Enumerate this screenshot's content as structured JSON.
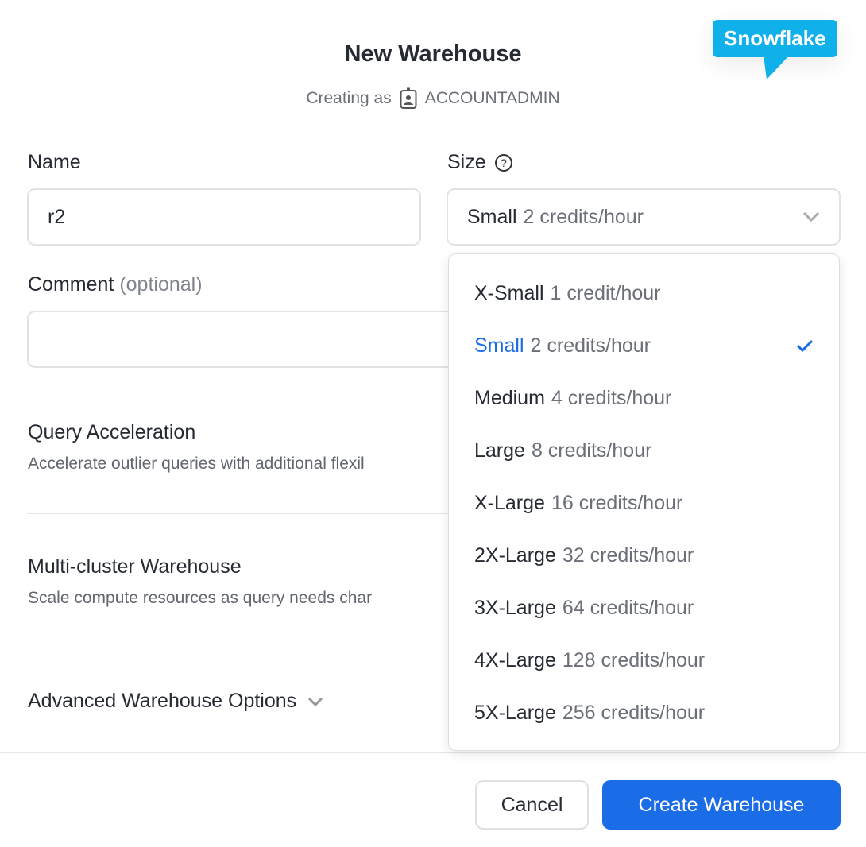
{
  "header": {
    "title": "New Warehouse",
    "creating_as": "Creating as",
    "role": "ACCOUNTADMIN",
    "brand_badge": "Snowflake"
  },
  "form": {
    "name_label": "Name",
    "name_value": "r2",
    "size_label": "Size",
    "size_selected_name": "Small",
    "size_selected_credits": "2 credits/hour",
    "comment_label": "Comment",
    "comment_optional": "(optional)",
    "comment_value": "",
    "query_acceleration": {
      "title": "Query Acceleration",
      "desc": "Accelerate outlier queries with additional flexil"
    },
    "multi_cluster": {
      "title": "Multi-cluster Warehouse",
      "desc": "Scale compute resources as query needs char"
    },
    "advanced_label": "Advanced Warehouse Options"
  },
  "size_options": [
    {
      "name": "X-Small",
      "credits": "1 credit/hour"
    },
    {
      "name": "Small",
      "credits": "2 credits/hour",
      "selected": true
    },
    {
      "name": "Medium",
      "credits": "4 credits/hour"
    },
    {
      "name": "Large",
      "credits": "8 credits/hour"
    },
    {
      "name": "X-Large",
      "credits": "16 credits/hour"
    },
    {
      "name": "2X-Large",
      "credits": "32 credits/hour"
    },
    {
      "name": "3X-Large",
      "credits": "64 credits/hour"
    },
    {
      "name": "4X-Large",
      "credits": "128 credits/hour"
    },
    {
      "name": "5X-Large",
      "credits": "256 credits/hour"
    }
  ],
  "footer": {
    "cancel": "Cancel",
    "create": "Create Warehouse"
  },
  "colors": {
    "accent": "#1a6ce7",
    "brand": "#10b0ea"
  }
}
